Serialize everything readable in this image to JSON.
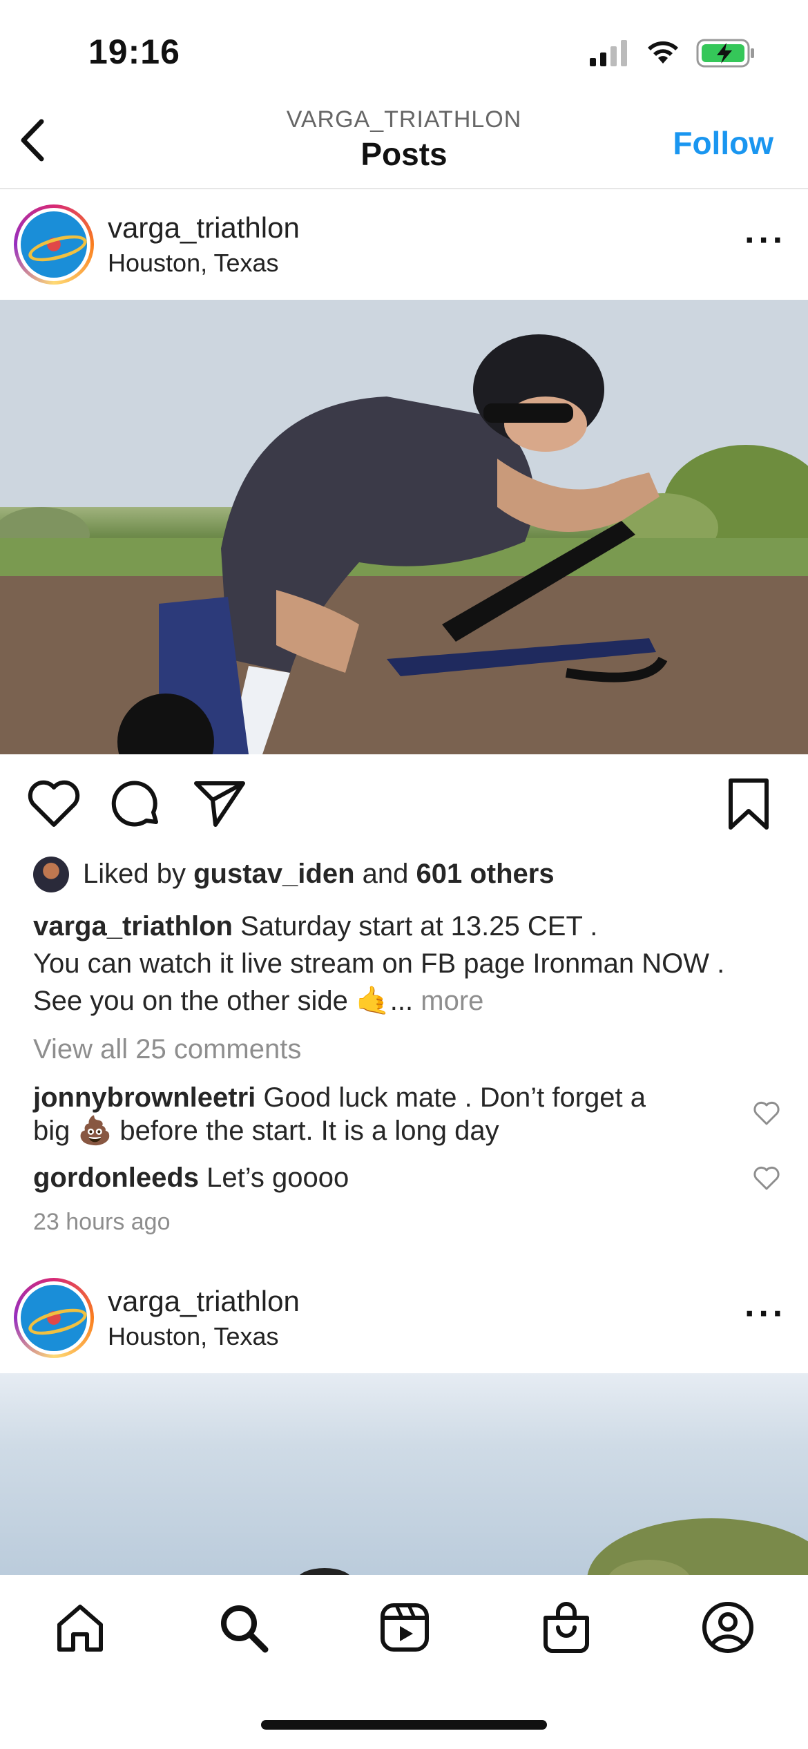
{
  "status_bar": {
    "time": "19:16"
  },
  "nav": {
    "subtitle": "VARGA_TRIATHLON",
    "title": "Posts",
    "follow_label": "Follow"
  },
  "post1": {
    "username": "varga_triathlon",
    "location": "Houston, Texas",
    "likes": {
      "prefix": "Liked by",
      "liker": "gustav_iden",
      "conj": "and",
      "others": "601 others"
    },
    "caption": {
      "username": "varga_triathlon",
      "line1": "Saturday start at 13.25 CET .",
      "line2": "You can watch it live stream on FB page Ironman NOW .",
      "line3": "See you on the other side 🤙...",
      "more": "more"
    },
    "view_comments": "View all 25 comments",
    "comments": [
      {
        "username": "jonnybrownleetri",
        "text_line1": "Good luck mate . Don’t forget a",
        "text_line2": "big 💩 before the start. It is a long day"
      },
      {
        "username": "gordonleeds",
        "text_line1": "Let’s goooo"
      }
    ],
    "timestamp": "23 hours ago"
  },
  "post2": {
    "username": "varga_triathlon",
    "location": "Houston, Texas"
  },
  "icons": {
    "back": "chevron-left-icon",
    "more": "more-horizontal-icon",
    "like": "heart-icon",
    "comment": "comment-icon",
    "share": "paper-plane-icon",
    "save": "bookmark-icon",
    "tabs": [
      "home-icon",
      "search-icon",
      "reels-icon",
      "shop-icon",
      "profile-icon"
    ]
  },
  "colors": {
    "accent": "#1a96f0",
    "text": "#262626",
    "muted": "#8e8e8e"
  }
}
